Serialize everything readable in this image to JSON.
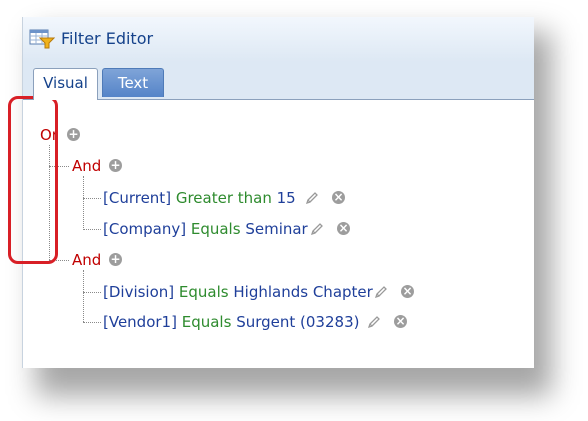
{
  "window": {
    "title": "Filter Editor",
    "title_icon": "filter-editor-icon"
  },
  "tabs": [
    {
      "label": "Visual",
      "active": true
    },
    {
      "label": "Text",
      "active": false
    }
  ],
  "tree": {
    "root": {
      "label": "Or"
    },
    "groups": [
      {
        "label": "And",
        "conditions": [
          {
            "field": "[Current]",
            "operator": "Greater than",
            "value": "15"
          },
          {
            "field": "[Company]",
            "operator": "Equals",
            "value": "Seminar"
          }
        ]
      },
      {
        "label": "And",
        "conditions": [
          {
            "field": "[Division]",
            "operator": "Equals",
            "value": "Highlands Chapter"
          },
          {
            "field": "[Vendor1]",
            "operator": "Equals",
            "value": "Surgent (03283)"
          }
        ]
      }
    ]
  },
  "colors": {
    "group": "#c00000",
    "field": "#1f3f9a",
    "operator": "#2e8b2e",
    "highlight": "#d81f26",
    "active_tab": "#ffffff",
    "inactive_tab": "#5584c8"
  },
  "icons": [
    "add-icon",
    "edit-pencil-icon",
    "remove-icon"
  ]
}
